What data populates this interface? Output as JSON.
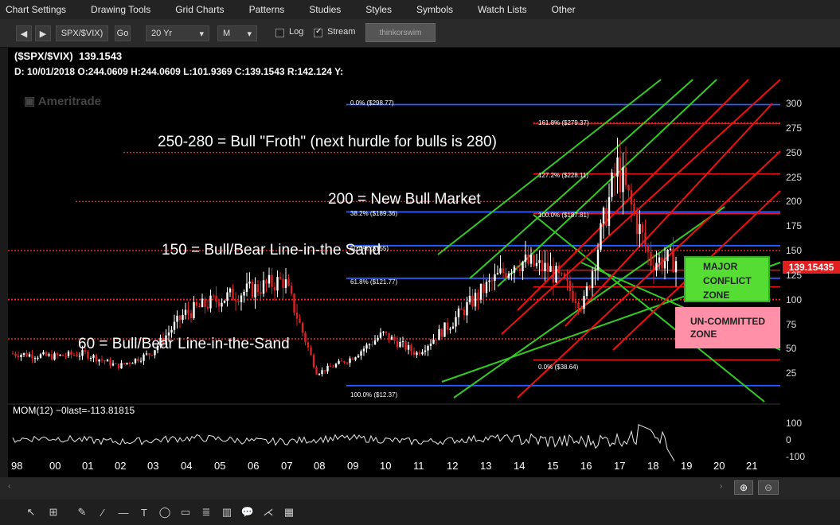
{
  "menu": [
    "Chart Settings",
    "Drawing Tools",
    "Grid Charts",
    "Patterns",
    "Studies",
    "Styles",
    "Symbols",
    "Watch Lists",
    "Other"
  ],
  "toolbar": {
    "symbol": "SPX/$VIX)",
    "go": "Go",
    "timeframe": "20 Yr",
    "aggregation": "M",
    "log_label": "Log",
    "stream_label": "Stream",
    "logo_label": "thinkorswim"
  },
  "chart": {
    "title": "($SPX/$VIX)",
    "last_value": "139.1543",
    "ohlc": "D:  10/01/2018  O:244.0609  H:244.0609  L:101.9369  C:139.1543    R:142.124    Y:",
    "watermark": "Ameritrade",
    "price_tag": "139.15435",
    "annotations": {
      "froth": "250-280 = Bull \"Froth\" (next hurdle for bulls is 280)",
      "new_bull": "200 = New Bull Market",
      "line150": "150 = Bull/Bear Line-in-the Sand",
      "line60": "60 = Bull/Bear Line-in-the-Sand"
    },
    "fib_labels": [
      "0.0%  ($298.77)",
      "161.8%  ($279.37)",
      "127.2%  ($228.11)",
      "38.2%  ($189.36)",
      "100.0%  ($187.81)",
      "61.8%  ($121.77)",
      "0.0%  ($38.64)",
      "100.0%  ($12.37)",
      "50.0%  ($155)"
    ],
    "zones": {
      "major": [
        "MAJOR",
        "CONFLICT",
        "ZONE"
      ],
      "uncommitted": [
        "UN-COMMITTED",
        "ZONE"
      ]
    },
    "y_ticks": [
      "300",
      "275",
      "250",
      "225",
      "200",
      "175",
      "150",
      "125",
      "100",
      "75",
      "50",
      "25"
    ],
    "x_ticks": [
      "98",
      "00",
      "01",
      "02",
      "03",
      "04",
      "05",
      "06",
      "07",
      "08",
      "09",
      "10",
      "11",
      "12",
      "13",
      "14",
      "15",
      "16",
      "17",
      "18",
      "19",
      "20",
      "21"
    ],
    "mom": {
      "label": "MOM(12)  −0last=-113.81815",
      "ticks": [
        "100",
        "0",
        "-100"
      ]
    },
    "colors": {
      "background": "#000000",
      "up_candle": "#ffffff",
      "down_candle": "#dd2222",
      "fib_line": "#2255ff",
      "green_channel": "#33cc22",
      "red_channel": "#ee1111"
    }
  },
  "chart_data": {
    "type": "candlestick",
    "title": "($SPX/$VIX)",
    "series": [
      {
        "name": "($SPX/$VIX)",
        "x": [
          "98",
          "00",
          "01",
          "02",
          "03",
          "04",
          "05",
          "06",
          "07",
          "08",
          "09",
          "10",
          "11",
          "12",
          "13",
          "14",
          "15",
          "16",
          "17",
          "18"
        ],
        "values": [
          45,
          42,
          45,
          32,
          45,
          85,
          100,
          110,
          120,
          25,
          40,
          65,
          45,
          75,
          110,
          140,
          130,
          95,
          235,
          140
        ]
      }
    ],
    "ylim": [
      0,
      310
    ],
    "y_tick_values": [
      300,
      275,
      250,
      225,
      200,
      175,
      150,
      125,
      100,
      75,
      50,
      25
    ],
    "horizontal_levels": [
      280,
      250,
      200,
      150,
      100,
      60
    ]
  }
}
